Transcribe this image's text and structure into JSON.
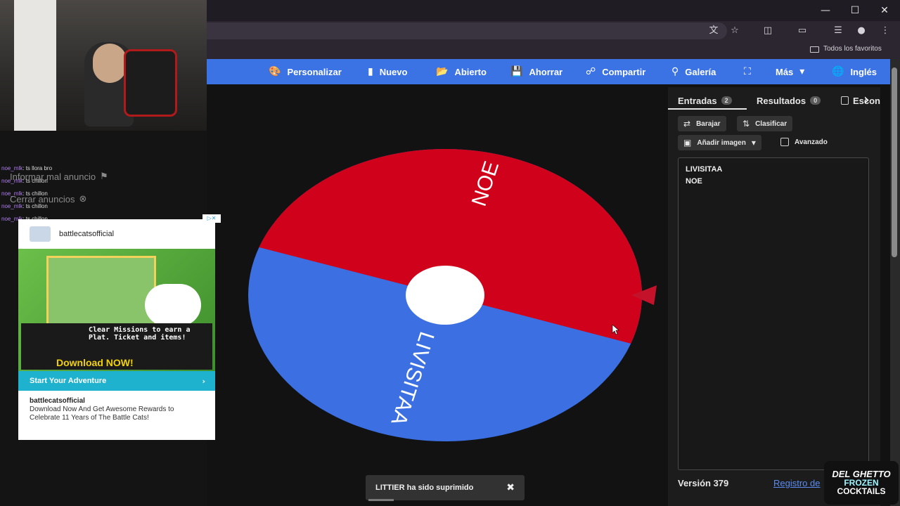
{
  "toolbar": {
    "personalizar": "Personalizar",
    "nuevo": "Nuevo",
    "abierto": "Abierto",
    "ahorrar": "Ahorrar",
    "compartir": "Compartir",
    "galeria": "Galería",
    "mas": "Más",
    "idioma": "Inglés"
  },
  "bookmarks": {
    "all": "Todos los favoritos"
  },
  "wheel": {
    "segments": [
      {
        "label": "NOE",
        "color": "#d0021b"
      },
      {
        "label": "LIVISITAA",
        "color": "#3b6fe2"
      }
    ]
  },
  "sidebar": {
    "tab_entries": "Entradas",
    "tab_entries_count": "2",
    "tab_results": "Resultados",
    "tab_results_count": "0",
    "tab_hide_partial": "Escon",
    "shuffle": "Barajar",
    "sort": "Clasificar",
    "add_image": "Añadir imagen",
    "advanced": "Avanzado",
    "entries": [
      "LIVISITAA",
      "NOE"
    ],
    "version": "Versión 379",
    "changelog": "Registro de"
  },
  "toast": {
    "message": "LITTIER ha sido suprimido"
  },
  "overlay": {
    "report_ad": "Informar mal anuncio",
    "close_ads": "Cerrar anuncios",
    "chat": [
      {
        "user": "noe_mlk",
        "text": ": ts llora bro"
      },
      {
        "user": "noe_mlk",
        "text": ": ts chillon"
      },
      {
        "user": "noe_mlk",
        "text": ": ts chillon"
      },
      {
        "user": "noe_mlk",
        "text": ": ts chillon"
      },
      {
        "user": "noe_mlk",
        "text": ": ts chillon"
      }
    ],
    "ad": {
      "brand": "battlecatsofficial",
      "banner_text": "Clear Missions to earn a Plat. Ticket and items!",
      "download": "Download NOW!",
      "cta": "Start Your Adventure",
      "body_title": "battlecatsofficial",
      "body": "Download Now And Get Awesome Rewards to Celebrate 11 Years of The Battle Cats!"
    },
    "logo": {
      "line1": "DEL GHETTO",
      "line2": "FROZEN",
      "line3": "COCKTAILS"
    }
  }
}
